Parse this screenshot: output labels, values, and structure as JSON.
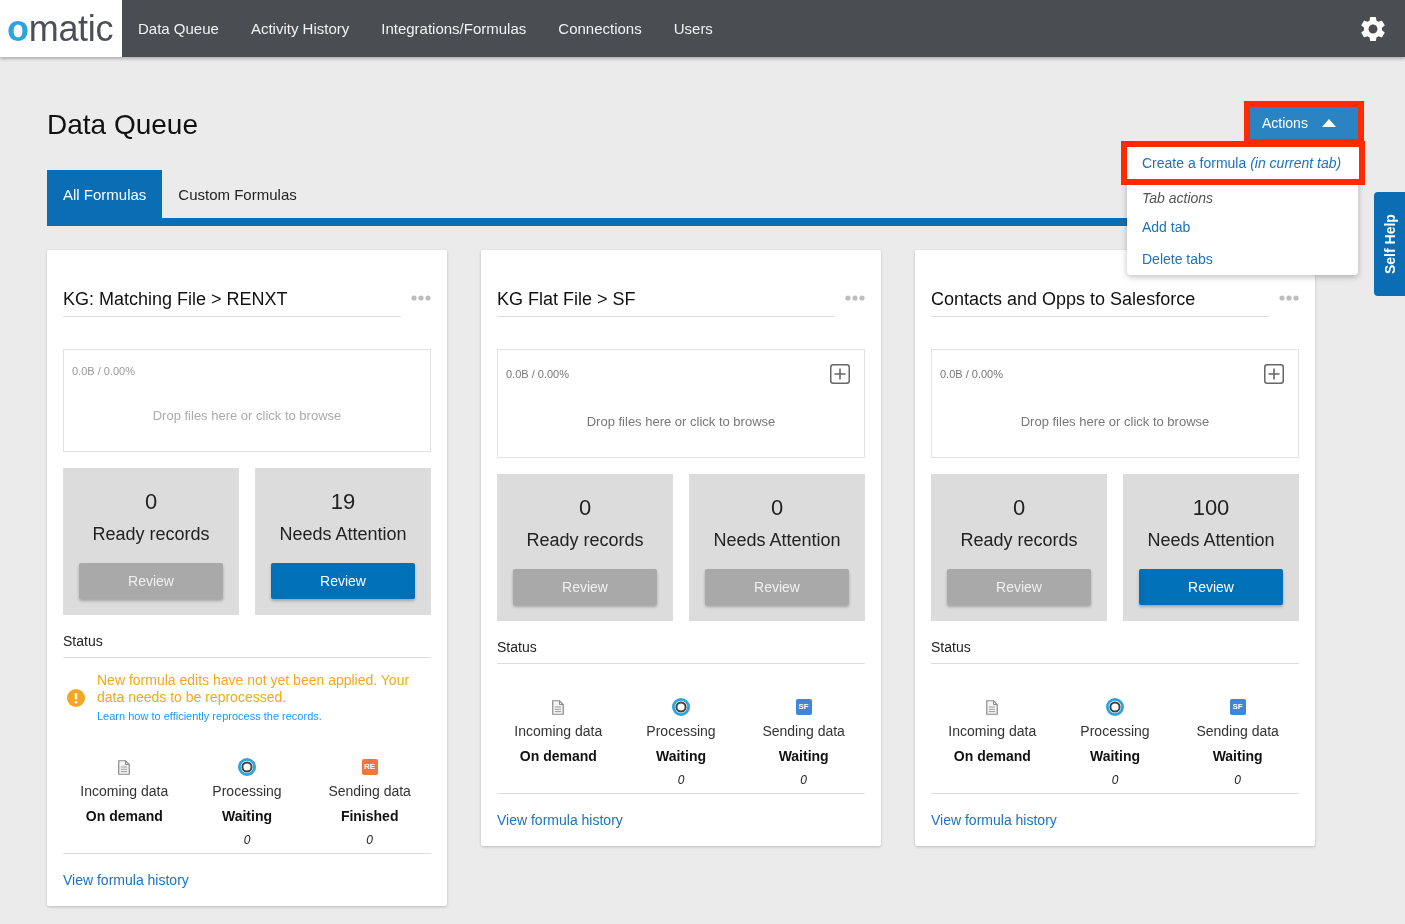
{
  "nav": {
    "logo": "omatic",
    "items": [
      "Data Queue",
      "Activity History",
      "Integrations/Formulas",
      "Connections",
      "Users"
    ]
  },
  "header": {
    "title": "Data Queue"
  },
  "actions": {
    "label": "Actions",
    "expanded": true,
    "highlighted": true,
    "menu": [
      {
        "kind": "item",
        "label": "Create a formula *(in current tab)*",
        "highlighted": true
      },
      {
        "kind": "heading",
        "label": "Tab actions"
      },
      {
        "kind": "item",
        "label": "Add tab",
        "highlighted": false
      },
      {
        "kind": "item",
        "label": "Delete tabs",
        "highlighted": false
      }
    ]
  },
  "tabs": [
    {
      "label": "All Formulas",
      "selected": true
    },
    {
      "label": "Custom Formulas",
      "selected": false
    }
  ],
  "self_help": "Self Help",
  "cards": [
    {
      "title": "KG: Matching File > RENXT",
      "dropzone": {
        "usage": "0.0B / 0.00%",
        "hint": "Drop files here or click to browse",
        "disabled": true
      },
      "stats": [
        {
          "value": "0",
          "label": "Ready records",
          "button": "Review",
          "disabled": true
        },
        {
          "value": "19",
          "label": "Needs Attention",
          "button": "Review",
          "disabled": false
        }
      ],
      "status": {
        "heading": "Status",
        "warning": {
          "message": "New formula edits have not yet been applied. Your data needs to be reprocessed.",
          "link": "Learn how to efficiently reprocess the records."
        },
        "steps": [
          {
            "kind": "incoming",
            "label": "Incoming data",
            "value": "On demand"
          },
          {
            "kind": "processing",
            "label": "Processing",
            "value": "Waiting",
            "count": "0"
          },
          {
            "kind": "sending",
            "label": "Sending data",
            "value": "Finished",
            "count": "0",
            "logo": "RE",
            "color": "#f2763a"
          }
        ]
      },
      "history_link": "View formula history"
    },
    {
      "title": "KG Flat File > SF",
      "dropzone": {
        "usage": "0.0B / 0.00%",
        "hint": "Drop files here or click to browse",
        "disabled": false
      },
      "stats": [
        {
          "value": "0",
          "label": "Ready records",
          "button": "Review",
          "disabled": true
        },
        {
          "value": "0",
          "label": "Needs Attention",
          "button": "Review",
          "disabled": true
        }
      ],
      "status": {
        "heading": "Status",
        "steps": [
          {
            "kind": "incoming",
            "label": "Incoming data",
            "value": "On demand"
          },
          {
            "kind": "processing",
            "label": "Processing",
            "value": "Waiting",
            "count": "0"
          },
          {
            "kind": "sending",
            "label": "Sending data",
            "value": "Waiting",
            "count": "0",
            "logo": "SF",
            "color": "#3d86d9"
          }
        ]
      },
      "history_link": "View formula history"
    },
    {
      "title": "Contacts and Opps to Salesforce",
      "dropzone": {
        "usage": "0.0B / 0.00%",
        "hint": "Drop files here or click to browse",
        "disabled": false
      },
      "stats": [
        {
          "value": "0",
          "label": "Ready records",
          "button": "Review",
          "disabled": true
        },
        {
          "value": "100",
          "label": "Needs Attention",
          "button": "Review",
          "disabled": false
        }
      ],
      "status": {
        "heading": "Status",
        "steps": [
          {
            "kind": "incoming",
            "label": "Incoming data",
            "value": "On demand"
          },
          {
            "kind": "processing",
            "label": "Processing",
            "value": "Waiting",
            "count": "0"
          },
          {
            "kind": "sending",
            "label": "Sending data",
            "value": "Waiting",
            "count": "0",
            "logo": "SF",
            "color": "#3d86d9"
          }
        ]
      },
      "history_link": "View formula history"
    }
  ]
}
